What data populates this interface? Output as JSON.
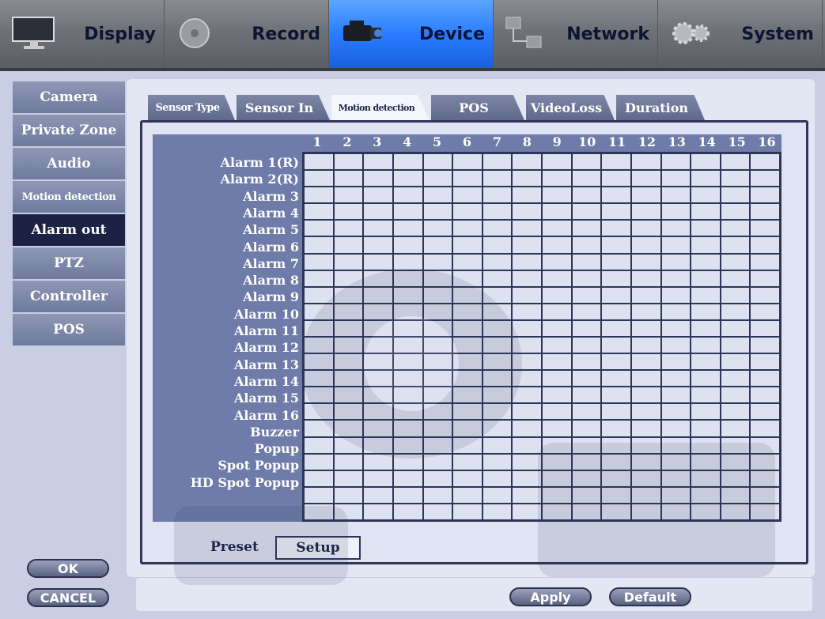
{
  "topnav": [
    {
      "label": "Display",
      "icon": "monitor-icon"
    },
    {
      "label": "Record",
      "icon": "disc-icon"
    },
    {
      "label": "Device",
      "icon": "camcorder-icon",
      "active": true
    },
    {
      "label": "Network",
      "icon": "network-icon"
    },
    {
      "label": "System",
      "icon": "gears-icon"
    }
  ],
  "sidebar": {
    "items": [
      {
        "label": "Camera"
      },
      {
        "label": "Private Zone"
      },
      {
        "label": "Audio"
      },
      {
        "label": "Motion detection"
      },
      {
        "label": "Alarm out",
        "active": true
      },
      {
        "label": "PTZ"
      },
      {
        "label": "Controller"
      },
      {
        "label": "POS"
      }
    ]
  },
  "tabs": [
    {
      "label": "Sensor Type"
    },
    {
      "label": "Sensor In"
    },
    {
      "label": "Motion detection",
      "active": true
    },
    {
      "label": "POS"
    },
    {
      "label": "VideoLoss"
    },
    {
      "label": "Duration"
    }
  ],
  "grid": {
    "columns": [
      "1",
      "2",
      "3",
      "4",
      "5",
      "6",
      "7",
      "8",
      "9",
      "10",
      "11",
      "12",
      "13",
      "14",
      "15",
      "16"
    ],
    "rows": [
      "Alarm 1(R)",
      "Alarm 2(R)",
      "Alarm 3",
      "Alarm 4",
      "Alarm 5",
      "Alarm 6",
      "Alarm 7",
      "Alarm 8",
      "Alarm 9",
      "Alarm 10",
      "Alarm 11",
      "Alarm 12",
      "Alarm 13",
      "Alarm 14",
      "Alarm 15",
      "Alarm 16",
      "Buzzer",
      "Popup",
      "Spot Popup",
      "HD Spot Popup"
    ]
  },
  "preset": {
    "label": "Preset",
    "button": "Setup"
  },
  "buttons": {
    "ok": "OK",
    "cancel": "CANCEL",
    "apply": "Apply",
    "default": "Default"
  },
  "colors": {
    "active_tab": "#2a7cff",
    "sidebar_active": "#1b2244",
    "grid_header": "#6f7ba8"
  }
}
